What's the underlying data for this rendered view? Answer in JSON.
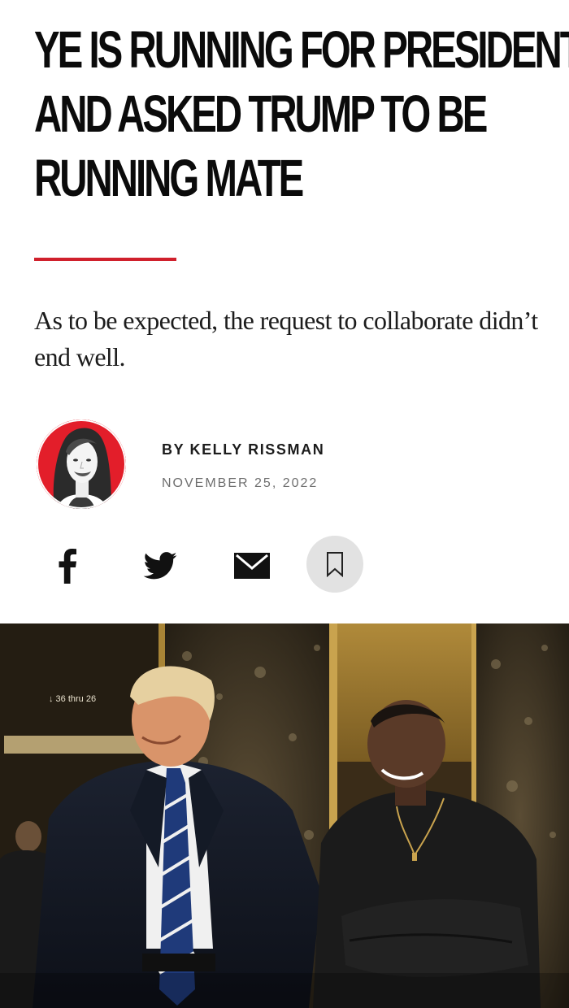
{
  "article": {
    "headline_lines": [
      "YE IS RUNNING FOR PRESIDENT",
      "AND ASKED TRUMP TO BE",
      "RUNNING MATE"
    ],
    "dek": "As to be expected, the request to collaborate didn’t end well.",
    "byline": "BY KELLY RISSMAN",
    "date": "NOVEMBER 25, 2022"
  },
  "share": {
    "facebook_icon": "facebook-icon",
    "twitter_icon": "twitter-icon",
    "email_icon": "mail-icon",
    "bookmark_icon": "bookmark-icon"
  },
  "hero_photo": {
    "elevator_sign": "↓ 36 thru 26"
  },
  "colors": {
    "accent_rule": "#d0202c",
    "avatar_bg": "#e31e2a",
    "bookmark_bg": "#e2e2e2",
    "text": "#0b0b0b"
  }
}
